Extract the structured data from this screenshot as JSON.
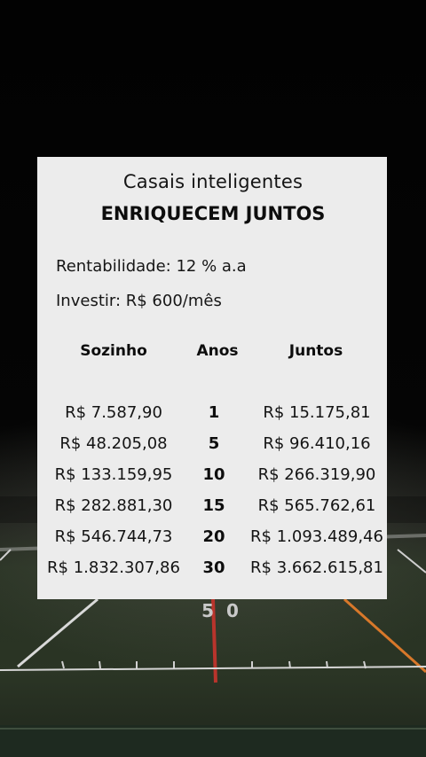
{
  "heading": {
    "line1": "Casais inteligentes",
    "line2": "ENRIQUECEM JUNTOS"
  },
  "params": {
    "rentabilidade": "Rentabilidade: 12 % a.a",
    "investir": "Investir: R$ 600/mês"
  },
  "table": {
    "headers": {
      "sozinho": "Sozinho",
      "anos": "Anos",
      "juntos": "Juntos"
    },
    "rows": [
      {
        "sozinho": "R$ 7.587,90",
        "anos": "1",
        "juntos": "R$ 15.175,81"
      },
      {
        "sozinho": "R$ 48.205,08",
        "anos": "5",
        "juntos": "R$ 96.410,16"
      },
      {
        "sozinho": "R$ 133.159,95",
        "anos": "10",
        "juntos": "R$ 266.319,90"
      },
      {
        "sozinho": "R$ 282.881,30",
        "anos": "15",
        "juntos": "R$ 565.762,61"
      },
      {
        "sozinho": "R$ 546.744,73",
        "anos": "20",
        "juntos": "R$ 1.093.489,46"
      },
      {
        "sozinho": "R$ 1.832.307,86",
        "anos": "30",
        "juntos": "R$ 3.662.615,81"
      }
    ]
  },
  "field": {
    "yard_marker": "50"
  },
  "colors": {
    "card": "#ececec",
    "text": "#111111",
    "field_green": "#2b3525",
    "field_red_line": "#b8342c",
    "field_orange_line": "#d8782a"
  }
}
